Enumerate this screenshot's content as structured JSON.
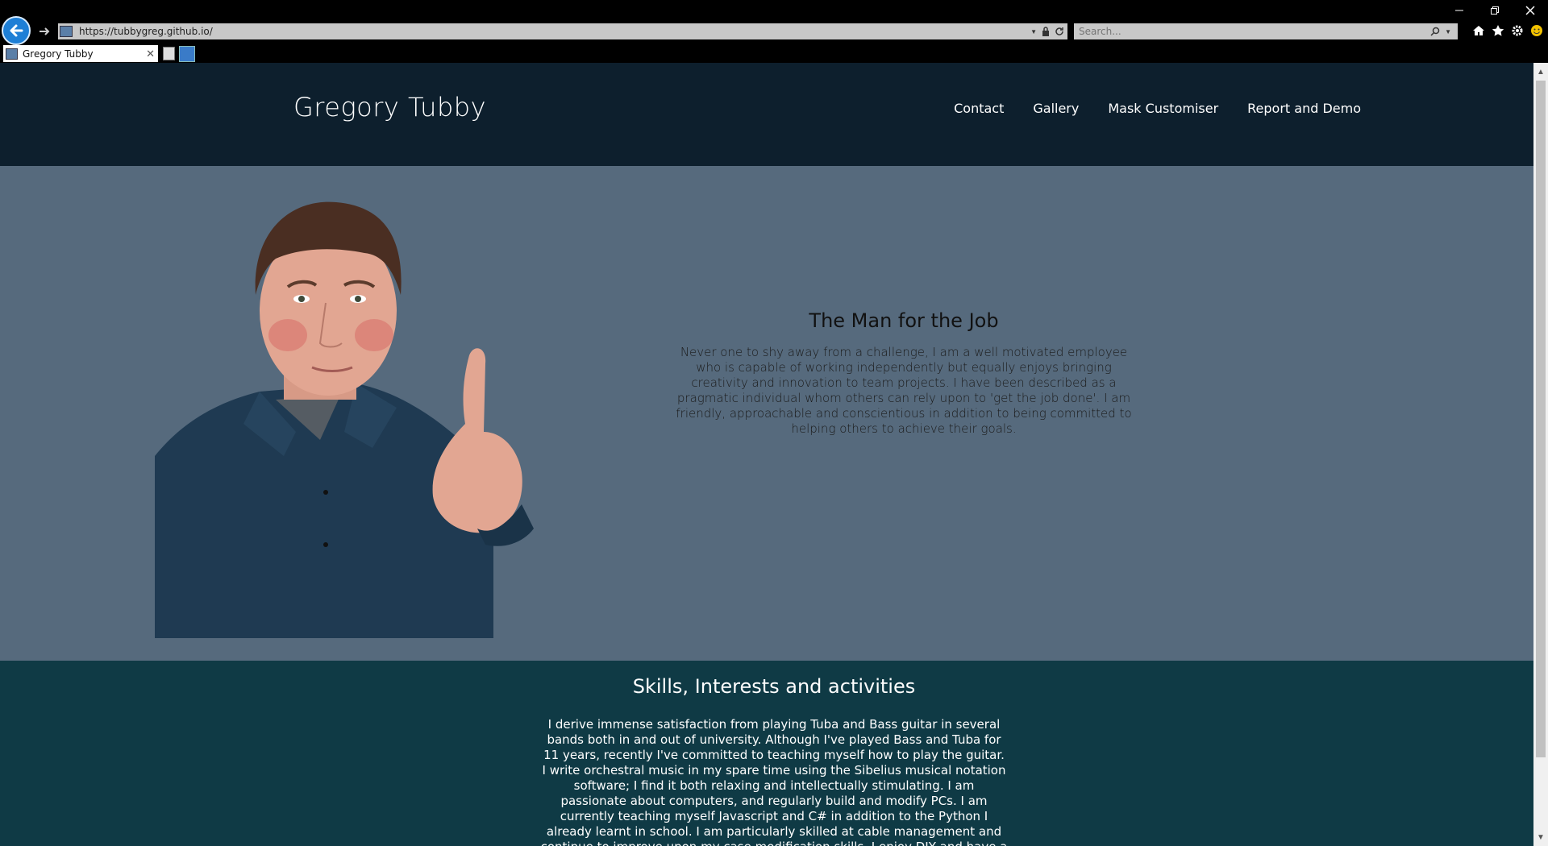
{
  "browser": {
    "url_scheme": "https",
    "url_host": "tubbygreg.github.io/",
    "search_placeholder": "Search...",
    "tab_title": "Gregory Tubby"
  },
  "site": {
    "title": "Gregory Tubby",
    "nav": [
      "Contact",
      "Gallery",
      "Mask Customiser",
      "Report and Demo"
    ]
  },
  "hero": {
    "heading": "The Man for the Job",
    "body": "Never one to shy away from a challenge, I am a well motivated employee who is capable of working independently but equally enjoys bringing creativity and innovation to team projects. I have been described as a pragmatic individual whom others can rely upon to 'get the job done'. I am friendly, approachable and conscientious in addition to being committed to helping others to achieve their goals."
  },
  "skills": {
    "heading": "Skills, Interests and activities",
    "body": "I derive immense satisfaction from playing Tuba and Bass guitar in several bands both in and out of university. Although I've played Bass and Tuba for 11 years, recently I've committed to teaching myself how to play the guitar. I write orchestral music in my spare time using the Sibelius musical notation software; I find it both relaxing and intellectually stimulating. I am passionate about computers, and regularly build and modify PCs. I am currently teaching myself Javascript and C# in addition to the Python I already learnt in school. I am particularly skilled at cable management and continue to improve upon my case modification skills. I enjoy DIY and have a good working knowledge"
  },
  "colors": {
    "header_bg": "#0d1f2d",
    "hero_bg": "#566a7d",
    "skills_bg": "#0f3a45"
  }
}
